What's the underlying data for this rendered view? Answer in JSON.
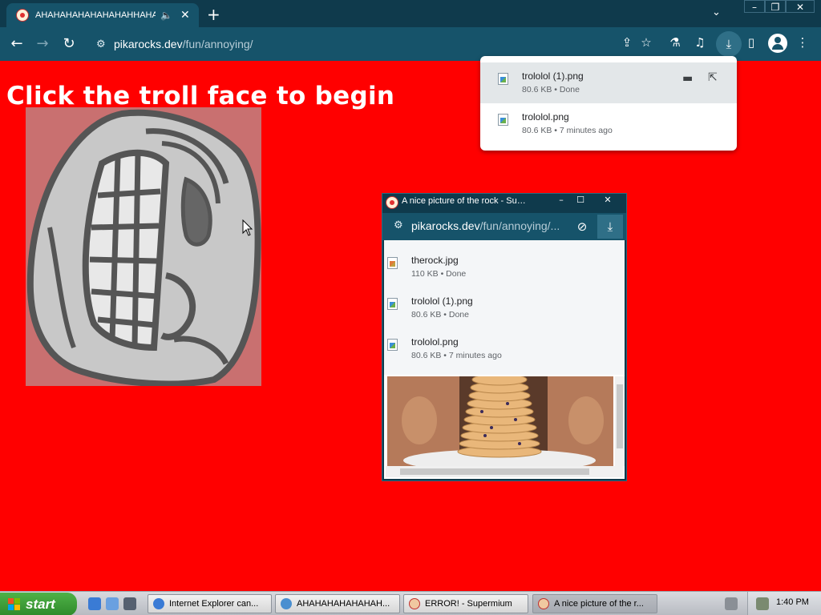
{
  "browser": {
    "tab_title": "AHAHAHAHAHAHAHAHHAHAHAHAHAHAHAH",
    "audio_icon": "speaker-icon",
    "url_host": "pikarocks.dev",
    "url_path": "/fun/annoying/"
  },
  "page": {
    "heading": "Click the troll face to begin",
    "background_color": "#ff0000"
  },
  "downloads_bubble": {
    "items": [
      {
        "name": "trololol (1).png",
        "meta": "80.6 KB • Done"
      },
      {
        "name": "trololol.png",
        "meta": "80.6 KB • 7 minutes ago"
      }
    ]
  },
  "popup": {
    "title": "A nice picture of the rock - Supermium",
    "url_host": "pikarocks.dev",
    "url_path": "/fun/annoying/...",
    "downloads": [
      {
        "name": "therock.jpg",
        "meta": "110 KB • Done"
      },
      {
        "name": "trololol (1).png",
        "meta": "80.6 KB • Done"
      },
      {
        "name": "trololol.png",
        "meta": "80.6 KB • 7 minutes ago"
      }
    ]
  },
  "taskbar": {
    "start_label": "start",
    "tasks": [
      {
        "label": "Internet Explorer can..."
      },
      {
        "label": "AHAHAHAHAHAHAH..."
      },
      {
        "label": "ERROR! - Supermium"
      },
      {
        "label": "A nice picture of the r..."
      }
    ],
    "clock": "1:40 PM"
  }
}
